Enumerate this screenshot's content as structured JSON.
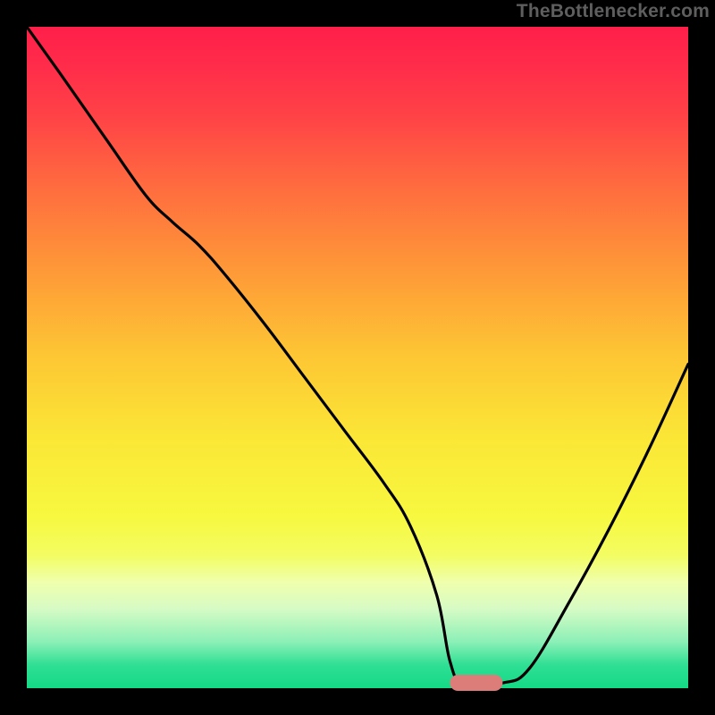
{
  "attribution": "TheBottlenecker.com",
  "colors": {
    "background": "#000000",
    "curve": "#000000",
    "marker": "#dd7d7a",
    "gradient_stops": [
      {
        "offset": 0.0,
        "color": "#ff1f4a"
      },
      {
        "offset": 0.06,
        "color": "#ff2c4a"
      },
      {
        "offset": 0.14,
        "color": "#ff4446"
      },
      {
        "offset": 0.24,
        "color": "#ff6b3f"
      },
      {
        "offset": 0.36,
        "color": "#fe9638"
      },
      {
        "offset": 0.5,
        "color": "#fdc734"
      },
      {
        "offset": 0.62,
        "color": "#fbe636"
      },
      {
        "offset": 0.74,
        "color": "#f7f83f"
      },
      {
        "offset": 0.8,
        "color": "#f3fd63"
      },
      {
        "offset": 0.84,
        "color": "#efffad"
      },
      {
        "offset": 0.88,
        "color": "#d7fbc5"
      },
      {
        "offset": 0.93,
        "color": "#8bf0b7"
      },
      {
        "offset": 0.965,
        "color": "#2fdf94"
      },
      {
        "offset": 1.0,
        "color": "#14d985"
      }
    ]
  },
  "chart_data": {
    "type": "line",
    "title": "",
    "xlabel": "",
    "ylabel": "",
    "xlim": [
      0,
      100
    ],
    "ylim": [
      0,
      100
    ],
    "grid": false,
    "legend": false,
    "series": [
      {
        "name": "bottleneck-curve",
        "x": [
          0.0,
          5.0,
          12.0,
          18.0,
          22.0,
          26.0,
          30.0,
          36.0,
          42.0,
          48.0,
          54.0,
          58.0,
          62.0,
          64.0,
          66.0,
          72.0,
          76.0,
          82.0,
          88.0,
          94.0,
          100.0
        ],
        "y": [
          100.0,
          93.0,
          83.0,
          74.5,
          70.5,
          67.0,
          62.5,
          55.0,
          47.0,
          39.0,
          31.0,
          24.5,
          14.0,
          4.0,
          0.8,
          0.8,
          3.0,
          13.0,
          24.0,
          36.0,
          49.0
        ]
      }
    ],
    "marker": {
      "x_start": 64.0,
      "x_end": 72.0,
      "y": 0.8
    }
  }
}
